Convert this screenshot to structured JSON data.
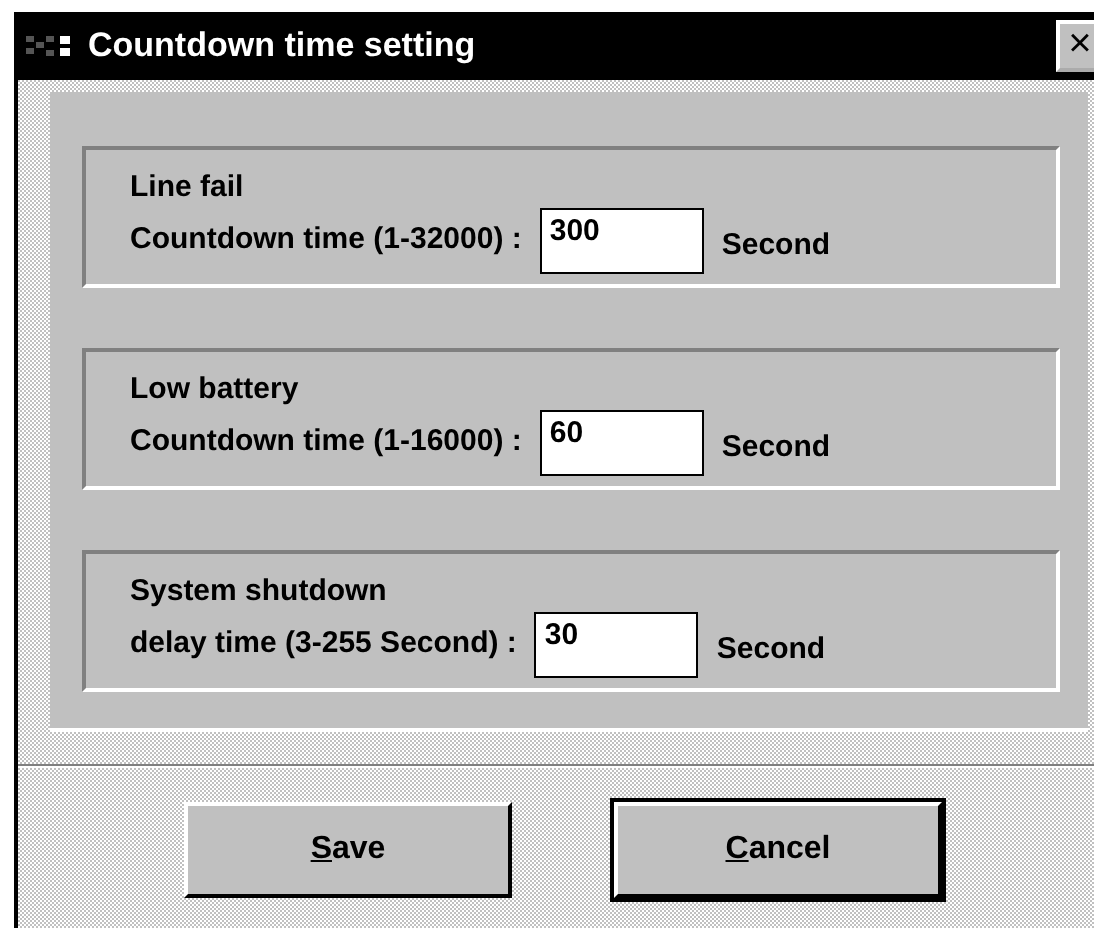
{
  "window": {
    "title": "Countdown time setting",
    "close": "×"
  },
  "groups": [
    {
      "title": "Line fail",
      "label": "Countdown time (1-32000) :",
      "value": "300",
      "unit": "Second"
    },
    {
      "title": "Low battery",
      "label": "Countdown time (1-16000) :",
      "value": "60",
      "unit": "Second"
    },
    {
      "title": "System shutdown",
      "label": "delay time (3-255 Second) :",
      "value": "30",
      "unit": "Second"
    }
  ],
  "buttons": [
    {
      "label": "Save",
      "mnemonic_underlined": true,
      "default": false
    },
    {
      "label": "Cancel",
      "mnemonic_underlined": true,
      "default": true
    }
  ]
}
